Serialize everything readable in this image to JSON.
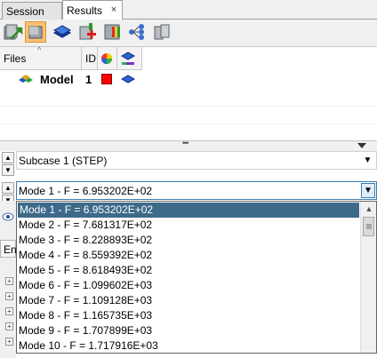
{
  "tabs": [
    {
      "label": "Session",
      "active": false
    },
    {
      "label": "Results",
      "active": true
    }
  ],
  "tab_close": "×",
  "toolbar": {
    "icons": [
      "import-results-icon",
      "model-view-icon",
      "layer-icon",
      "add-results-icon",
      "contour-icon",
      "tree-structure-icon",
      "cylinders-icon"
    ],
    "active_index": 1
  },
  "grid": {
    "columns": [
      "Files",
      "ID",
      "",
      ""
    ],
    "sort_indicator": "^",
    "rows": [
      {
        "name": "Model",
        "id": "1",
        "color": "#ff0000"
      }
    ]
  },
  "splitter": {
    "grip": "•••"
  },
  "subcase": {
    "value": "Subcase 1 (STEP)"
  },
  "mode": {
    "value": "Mode 1 - F = 6.953202E+02"
  },
  "dropdown": {
    "items": [
      "Mode 1 - F = 6.953202E+02",
      "Mode 2 - F = 7.681317E+02",
      "Mode 3 - F = 8.228893E+02",
      "Mode 4 - F = 8.559392E+02",
      "Mode 5 - F = 8.618493E+02",
      "Mode 6 - F = 1.099602E+03",
      "Mode 7 - F = 1.109128E+03",
      "Mode 8 - F = 1.165735E+03",
      "Mode 9 - F = 1.707899E+03",
      "Mode 10 - F = 1.717916E+03"
    ],
    "selected_index": 0
  },
  "left_strip": {
    "label": "En"
  },
  "colors": {
    "selection": "#3e6a8a",
    "focus_border": "#3c7fb1",
    "active_tool": "#f9c178"
  }
}
